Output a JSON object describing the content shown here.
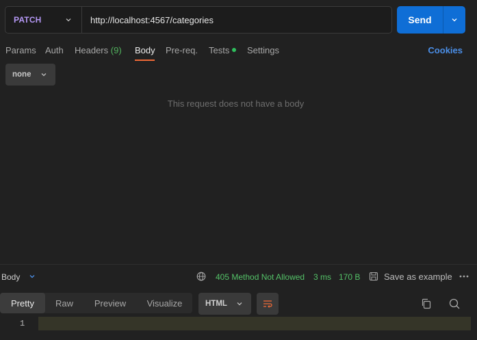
{
  "request": {
    "method": "PATCH",
    "url": "http://localhost:4567/categories",
    "send_label": "Send"
  },
  "tabs": [
    {
      "label": "Params"
    },
    {
      "label": "Auth"
    },
    {
      "label": "Headers",
      "count": "(9)"
    },
    {
      "label": "Body",
      "active": true
    },
    {
      "label": "Pre-req."
    },
    {
      "label": "Tests"
    },
    {
      "label": "Settings"
    }
  ],
  "cookies_label": "Cookies",
  "body_type": "none",
  "empty_message": "This request does not have a body",
  "response": {
    "section_label": "Body",
    "status": "405 Method Not Allowed",
    "time": "3 ms",
    "size": "170 B",
    "save_label": "Save as example",
    "view_tabs": [
      "Pretty",
      "Raw",
      "Preview",
      "Visualize"
    ],
    "active_view": "Pretty",
    "format": "HTML",
    "line_number": "1"
  },
  "colors": {
    "method": "#b598f5",
    "send": "#0f6ed6",
    "active_tab_underline": "#ef6a37",
    "status_ok_text": "#54c268",
    "cookies_link": "#4b8fe8"
  }
}
